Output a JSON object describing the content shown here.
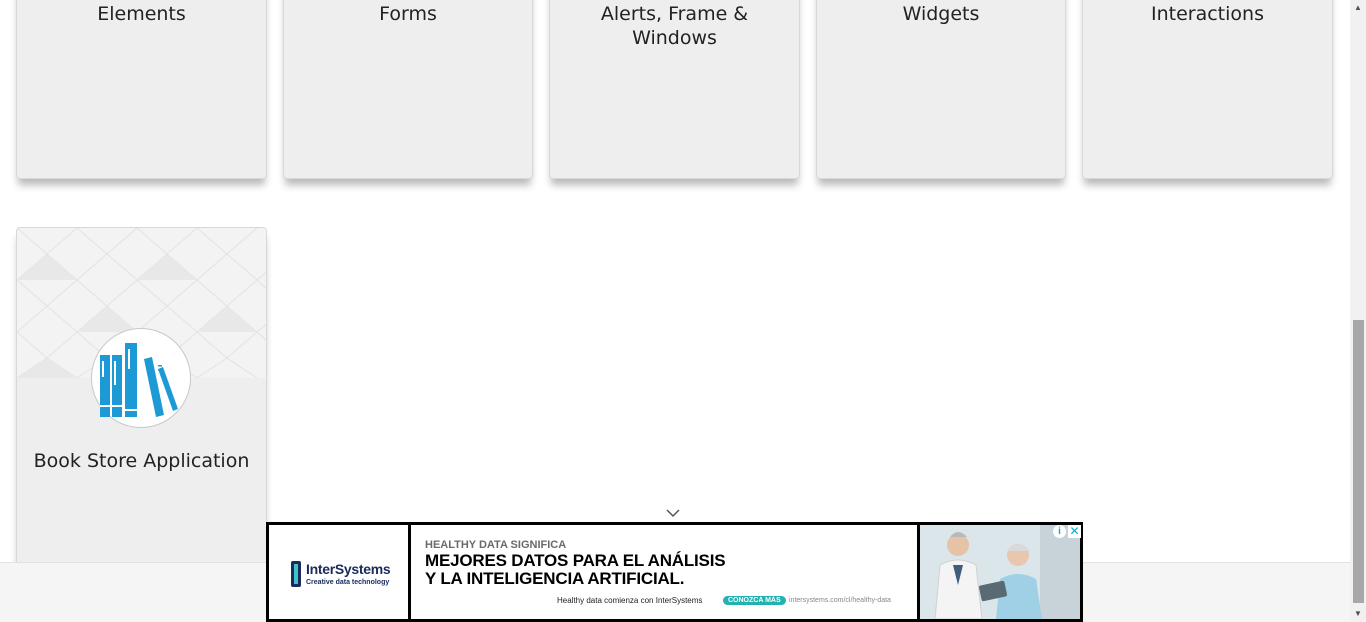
{
  "categories": [
    {
      "title": "Elements"
    },
    {
      "title": "Forms"
    },
    {
      "title": "Alerts, Frame & Windows"
    },
    {
      "title": "Widgets"
    },
    {
      "title": "Interactions"
    },
    {
      "title": "Book Store Application",
      "icon": "books-icon"
    }
  ],
  "ad": {
    "brand": "InterSystems",
    "tagline": "Creative data technology",
    "kicker": "HEALTHY DATA SIGNIFICA",
    "headline_line1": "MEJORES DATOS PARA EL ANÁLISIS",
    "headline_line2": "Y LA INTELIGENCIA ARTIFICIAL.",
    "sub": "Healthy data comienza con InterSystems",
    "cta": "CONOZCA MÁS",
    "url": "intersystems.com/cl/healthy-data",
    "info_icon": "info-icon",
    "close_icon": "close-icon"
  },
  "colors": {
    "card_bg": "#eeeeee",
    "book_blue": "#1d9ad6",
    "ad_accent": "#22b3b0"
  }
}
